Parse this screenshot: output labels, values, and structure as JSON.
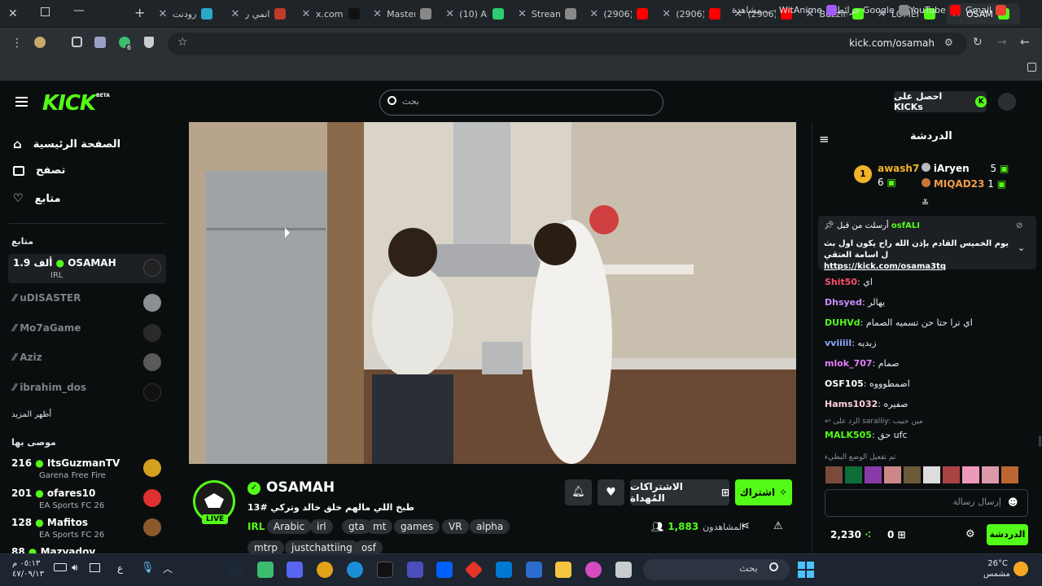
{
  "browser": {
    "tabs": [
      {
        "label": "رودنت",
        "color": "#2aa7c9"
      },
      {
        "label": "انمي ر",
        "color": "#c0392b"
      },
      {
        "label": "x.com",
        "color": "#111111"
      },
      {
        "label": "Master",
        "color": "#888888"
      },
      {
        "label": "(10) AI",
        "color": "#2ecc71"
      },
      {
        "label": "Stream",
        "color": "#888888"
      },
      {
        "label": "(2906)",
        "color": "#ff0000"
      },
      {
        "label": "(2906)",
        "color": "#ff0000"
      },
      {
        "label": "(2906)",
        "color": "#ff0000"
      },
      {
        "label": "Buzzin",
        "color": "#53fc18"
      },
      {
        "label": "LOMEI",
        "color": "#53fc18"
      },
      {
        "label": "OSAM",
        "color": "#53fc18"
      }
    ],
    "url": "kick.com/osamah",
    "extension_badge": "6",
    "bookmarks": [
      "Gmail",
      "YouTube",
      "خرائط Google",
      "مشاهدة... - WitAnime"
    ]
  },
  "header": {
    "logo": "KICK",
    "logo_badge": "BETA",
    "search_placeholder": "بحث",
    "get_kicks": "احصل على KICKs"
  },
  "sidebar": {
    "nav": [
      {
        "label": "الصفحة الرئيسية",
        "icon": "home-icon"
      },
      {
        "label": "تصفح",
        "icon": "browse-icon"
      },
      {
        "label": "متابع",
        "icon": "heart-icon"
      }
    ],
    "following_title": "متابع",
    "following": [
      {
        "name": "OSAMAH",
        "viewers": "1.9 ألف",
        "category": "IRL",
        "live": true
      },
      {
        "name": "uDISASTER",
        "live": false
      },
      {
        "name": "Mo7aGame",
        "live": false
      },
      {
        "name": "Aziz",
        "live": false
      },
      {
        "name": "ibrahim_dos",
        "live": false
      }
    ],
    "show_more": "أظهر المزيد",
    "recommended_title": "موصى بها",
    "recommended": [
      {
        "name": "ItsGuzmanTV",
        "viewers": "216",
        "category": "Garena Free Fire"
      },
      {
        "name": "ofares10",
        "viewers": "201",
        "category": "EA Sports FC 26"
      },
      {
        "name": "Mafitos",
        "viewers": "128",
        "category": "EA Sports FC 26"
      },
      {
        "name": "Mazvadov",
        "viewers": "88",
        "category": ""
      }
    ]
  },
  "stream": {
    "name": "OSAMAH",
    "live": "LIVE",
    "title": "طبخ اللي مالهم خلق خالد وتركي #13",
    "category": "IRL",
    "tags": [
      "Arabic",
      "irl",
      "gta",
      "mt",
      "games",
      "VR",
      "alpha"
    ],
    "tags2": [
      "mtrp",
      "justchattiing",
      "osf"
    ],
    "viewers_label": "المشاهدون",
    "viewers": "1,883",
    "subscribe": "اشتراك",
    "gift_subs": "الاشتراكات المُهداة"
  },
  "chat": {
    "title": "الدردشة",
    "leaderboard": [
      {
        "rank": "1",
        "name": "awash7",
        "count": "6"
      },
      {
        "rank": "2",
        "name": "iAryen",
        "count": "5"
      },
      {
        "rank": "3",
        "name": "MIQAD23",
        "count": "1"
      }
    ],
    "pinned": {
      "header": "أرسلت من قبل",
      "user": "osfALI",
      "text": "يوم الخميس القادم بإذن الله راح يكون اول بث ل اسامة العتقي",
      "link": "https://kick.com/osama3tq"
    },
    "messages": [
      {
        "user": "Shit50",
        "text": "اي",
        "color": "#ff4d6d"
      },
      {
        "user": "Dhsyed",
        "text": "يهالر",
        "color": "#c98bff"
      },
      {
        "user": "DUHVd",
        "text": "اي ترا حتا حن تسميه الصمام",
        "color": "#53fc18"
      },
      {
        "user": "vviiiil",
        "text": "زبديه",
        "color": "#8fa8ff"
      },
      {
        "user": "mlok_707",
        "text": "صمام",
        "color": "#e37cff"
      },
      {
        "user": "OSF105",
        "text": "اضمطوووه",
        "color": "#ffffff"
      },
      {
        "user": "Hams1032",
        "text": "صفيره",
        "color": "#ffd0e0"
      }
    ],
    "reply_note": "الرد على saraliiy: مين حبيب",
    "reply_msg": {
      "user": "MALK505",
      "text": "حق ufc"
    },
    "slow_mode": "تم تفعيل الوضع البطيء",
    "input_placeholder": "إرسال رسالة",
    "points": "2,230",
    "kicks": "0",
    "chat_button": "الدردشة"
  },
  "taskbar": {
    "search": "بحث",
    "weather_temp": "26°C",
    "weather_label": "مشمس",
    "time": "٠٥:١٣ م",
    "date": "٤٧/٠٩/١٣",
    "lang": "ع"
  }
}
